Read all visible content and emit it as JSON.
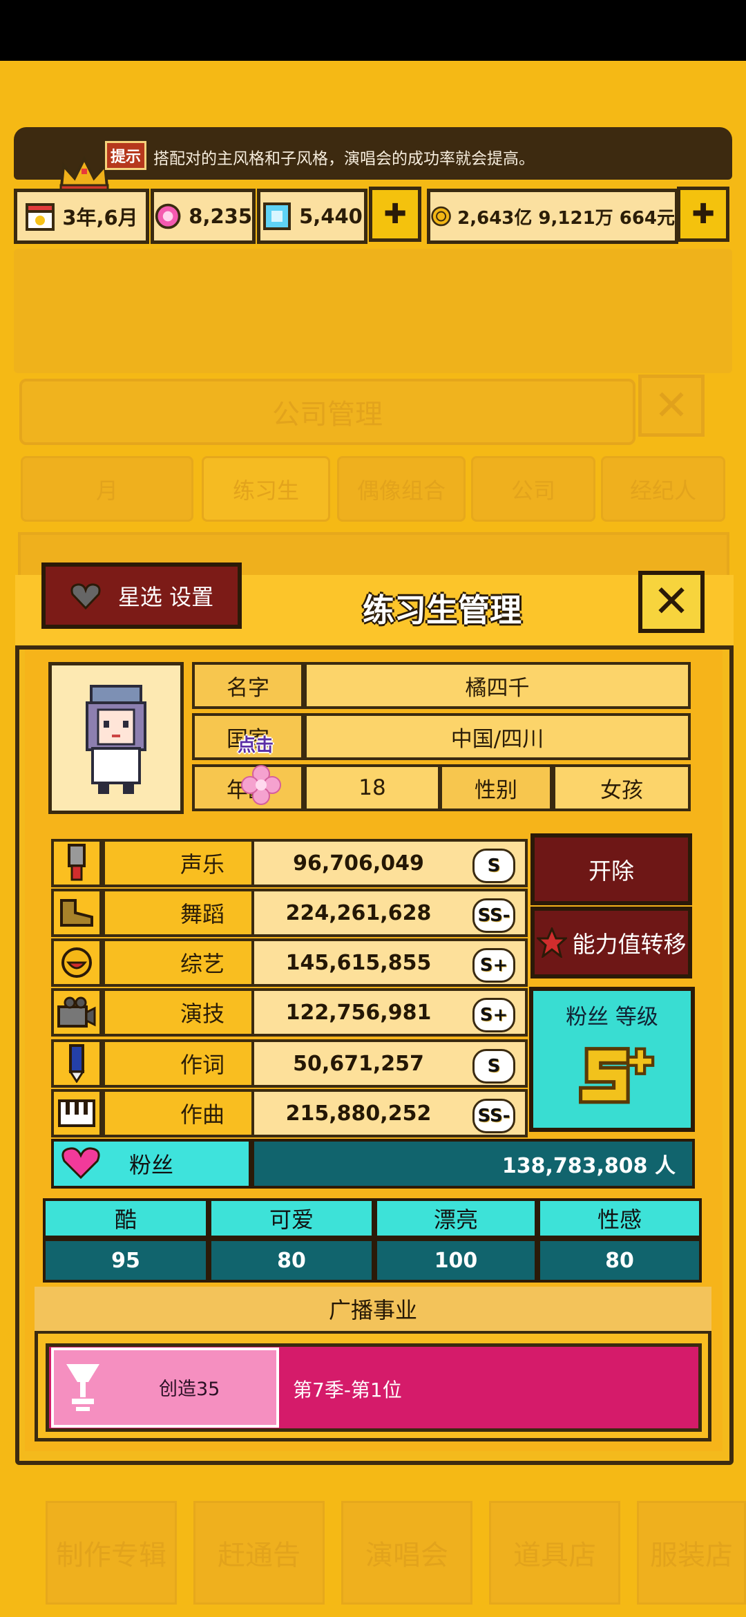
{
  "hint": {
    "badge": "提示",
    "text": "搭配对的主风格和子风格，演唱会的成功率就会提高。"
  },
  "resources": {
    "date": "3年,6月",
    "pink_gems": "8,235",
    "blue_gems": "5,440",
    "money": "2,643亿 9,121万 664元",
    "plus": "✚"
  },
  "background": {
    "title": "公司管理",
    "tabs": [
      "月",
      "练习生",
      "偶像组合",
      "公司",
      "经纪人"
    ],
    "bottom_menu": [
      "制作专辑",
      "赶通告",
      "演唱会",
      "道具店",
      "服装店"
    ]
  },
  "panel": {
    "title": "练习生管理",
    "star_settings": "星选 设置",
    "close": "✕"
  },
  "profile": {
    "name_key": "名字",
    "name": "橘四千",
    "country_key": "国家",
    "country": "中国/四川",
    "tap_hint": "点击",
    "age_key": "年龄",
    "age": "18",
    "gender_key": "性别",
    "gender": "女孩"
  },
  "stats": [
    {
      "label": "声乐",
      "value": "96,706,049",
      "grade": "S",
      "icon": "microphone-icon"
    },
    {
      "label": "舞蹈",
      "value": "224,261,628",
      "grade": "SS-",
      "icon": "shoe-icon"
    },
    {
      "label": "综艺",
      "value": "145,615,855",
      "grade": "S+",
      "icon": "smile-icon"
    },
    {
      "label": "演技",
      "value": "122,756,981",
      "grade": "S+",
      "icon": "camera-icon"
    },
    {
      "label": "作词",
      "value": "50,671,257",
      "grade": "S",
      "icon": "pen-icon"
    },
    {
      "label": "作曲",
      "value": "215,880,252",
      "grade": "SS-",
      "icon": "piano-icon"
    }
  ],
  "actions": {
    "dismiss": "开除",
    "transfer": "能力值转移"
  },
  "fan_level": {
    "label": "粉丝 等级",
    "grade": "S+"
  },
  "fans": {
    "label": "粉丝",
    "value": "138,783,808 人"
  },
  "styles": {
    "headers": [
      "酷",
      "可爱",
      "漂亮",
      "性感"
    ],
    "values": [
      "95",
      "80",
      "100",
      "80"
    ]
  },
  "broadcast": {
    "title": "广播事业",
    "show": "创造35",
    "rank": "第7季-第1位"
  },
  "colors": {
    "background": "#f5b915",
    "panel": "#f4ba1c",
    "teal": "#39ddd2",
    "dark_teal": "#11646d",
    "dark_red": "#6e1716",
    "magenta": "#d51b6a"
  }
}
